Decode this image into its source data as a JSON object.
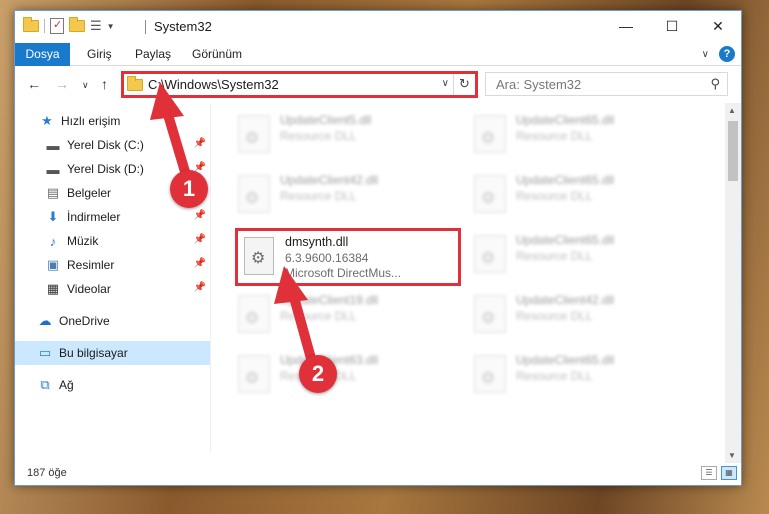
{
  "window": {
    "title": "System32"
  },
  "ribbon": {
    "tabs": [
      "Dosya",
      "Giriş",
      "Paylaş",
      "Görünüm"
    ],
    "help": "?"
  },
  "nav": {
    "address": "C:\\Windows\\System32",
    "search_placeholder": "Ara: System32"
  },
  "sidebar": {
    "items": [
      {
        "label": "Hızlı erişim",
        "icon": "star-icon",
        "pinned": false
      },
      {
        "label": "Yerel Disk (C:)",
        "icon": "drive-icon",
        "pinned": true
      },
      {
        "label": "Yerel Disk (D:)",
        "icon": "drive-icon",
        "pinned": true
      },
      {
        "label": "Belgeler",
        "icon": "document-icon",
        "pinned": true
      },
      {
        "label": "İndirmeler",
        "icon": "download-icon",
        "pinned": true
      },
      {
        "label": "Müzik",
        "icon": "music-icon",
        "pinned": true
      },
      {
        "label": "Resimler",
        "icon": "pictures-icon",
        "pinned": true
      },
      {
        "label": "Videolar",
        "icon": "video-icon",
        "pinned": true
      },
      {
        "label": "OneDrive",
        "icon": "cloud-icon",
        "pinned": false
      },
      {
        "label": "Bu bilgisayar",
        "icon": "computer-icon",
        "pinned": false,
        "selected": true
      },
      {
        "label": "Ağ",
        "icon": "network-icon",
        "pinned": false
      }
    ]
  },
  "files": {
    "left": [
      {
        "name": "UpdateClient5.dll",
        "type": "Resource DLL"
      },
      {
        "name": "UpdateClient42.dll",
        "type": "Resource DLL"
      },
      {
        "name": "UpdateClient19.dll",
        "type": "Resource DLL"
      },
      {
        "name": "UpdateClient63.dll",
        "type": "Resource DLL"
      }
    ],
    "right": [
      {
        "name": "UpdateClient65.dll",
        "type": "Resource DLL"
      },
      {
        "name": "UpdateClient65.dll",
        "type": "Resource DLL"
      },
      {
        "name": "UpdateClient65.dll",
        "type": "Resource DLL"
      },
      {
        "name": "UpdateClient42.dll",
        "type": "Resource DLL"
      },
      {
        "name": "UpdateClient65.dll",
        "type": "Resource DLL"
      }
    ],
    "highlighted": {
      "name": "dmsynth.dll",
      "version": "6.3.9600.16384",
      "description": "Microsoft DirectMus..."
    }
  },
  "status": {
    "item_count": "187 öğe"
  },
  "annotations": {
    "step1": "1",
    "step2": "2",
    "color": "#e0303a"
  }
}
